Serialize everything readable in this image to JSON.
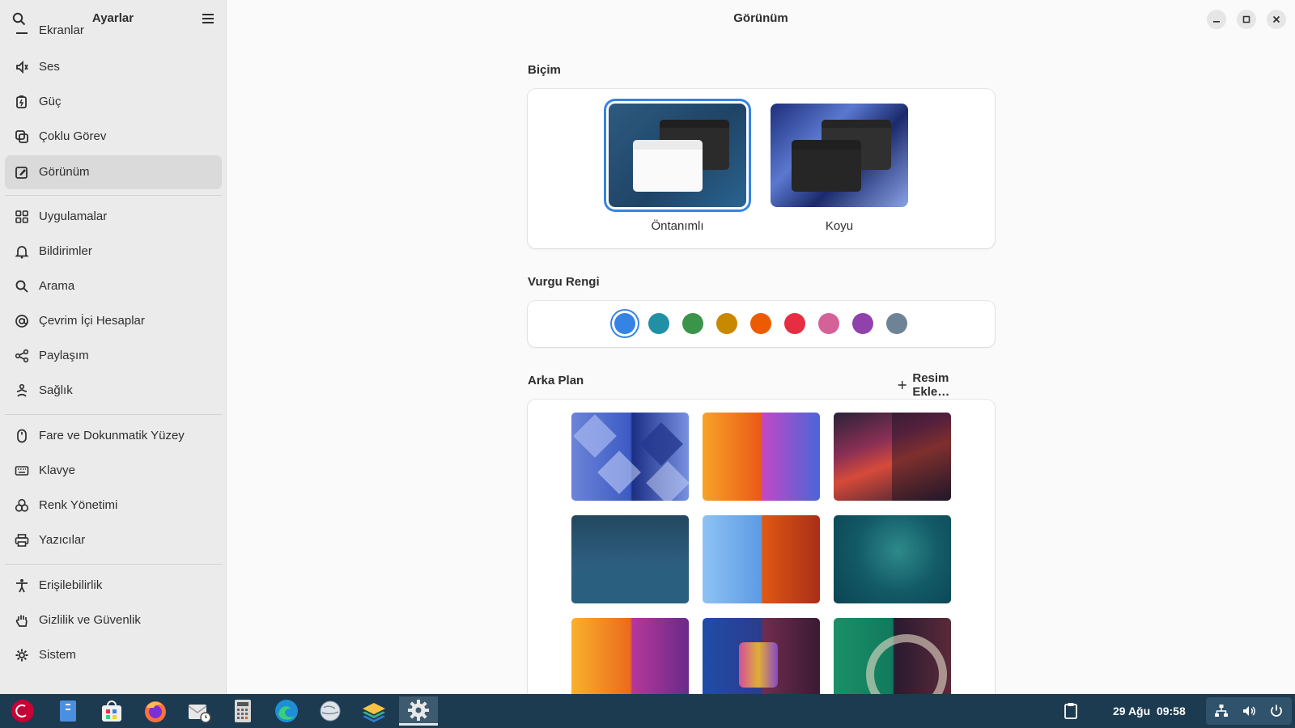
{
  "sidebar": {
    "title": "Ayarlar",
    "cut_item": "Ekranlar",
    "items": [
      {
        "label": "Ses",
        "icon": "speaker-icon"
      },
      {
        "label": "Güç",
        "icon": "battery-icon"
      },
      {
        "label": "Çoklu Görev",
        "icon": "multitasking-icon"
      },
      {
        "label": "Görünüm",
        "icon": "appearance-icon",
        "active": true
      },
      {
        "label": "Uygulamalar",
        "icon": "apps-grid-icon"
      },
      {
        "label": "Bildirimler",
        "icon": "bell-icon"
      },
      {
        "label": "Arama",
        "icon": "search-icon"
      },
      {
        "label": "Çevrim İçi Hesaplar",
        "icon": "at-sign-icon"
      },
      {
        "label": "Paylaşım",
        "icon": "share-icon"
      },
      {
        "label": "Sağlık",
        "icon": "health-icon"
      },
      {
        "label": "Fare ve Dokunmatik Yüzey",
        "icon": "mouse-icon"
      },
      {
        "label": "Klavye",
        "icon": "keyboard-icon"
      },
      {
        "label": "Renk Yönetimi",
        "icon": "color-icon"
      },
      {
        "label": "Yazıcılar",
        "icon": "printer-icon"
      },
      {
        "label": "Erişilebilirlik",
        "icon": "accessibility-icon"
      },
      {
        "label": "Gizlilik ve Güvenlik",
        "icon": "hand-icon"
      },
      {
        "label": "Sistem",
        "icon": "gear-icon"
      }
    ]
  },
  "main": {
    "title": "Görünüm",
    "style": {
      "heading": "Biçim",
      "options": [
        {
          "label": "Öntanımlı",
          "selected": true
        },
        {
          "label": "Koyu",
          "selected": false
        }
      ]
    },
    "accent": {
      "heading": "Vurgu Rengi",
      "colors": [
        "#3584e4",
        "#2190a4",
        "#3a944a",
        "#c88800",
        "#ed5b00",
        "#e62d42",
        "#d56199",
        "#9141ac",
        "#6f8396"
      ],
      "selected_index": 0
    },
    "background": {
      "heading": "Arka Plan",
      "add_label": "Resim Ekle…"
    }
  },
  "taskbar": {
    "apps": [
      "debian-menu-icon",
      "files-icon",
      "software-icon",
      "firefox-icon",
      "mail-icon",
      "calculator-icon",
      "edge-icon",
      "globe-icon",
      "layers-icon",
      "settings-icon"
    ],
    "date": "29 Ağu",
    "time": "09:58"
  }
}
